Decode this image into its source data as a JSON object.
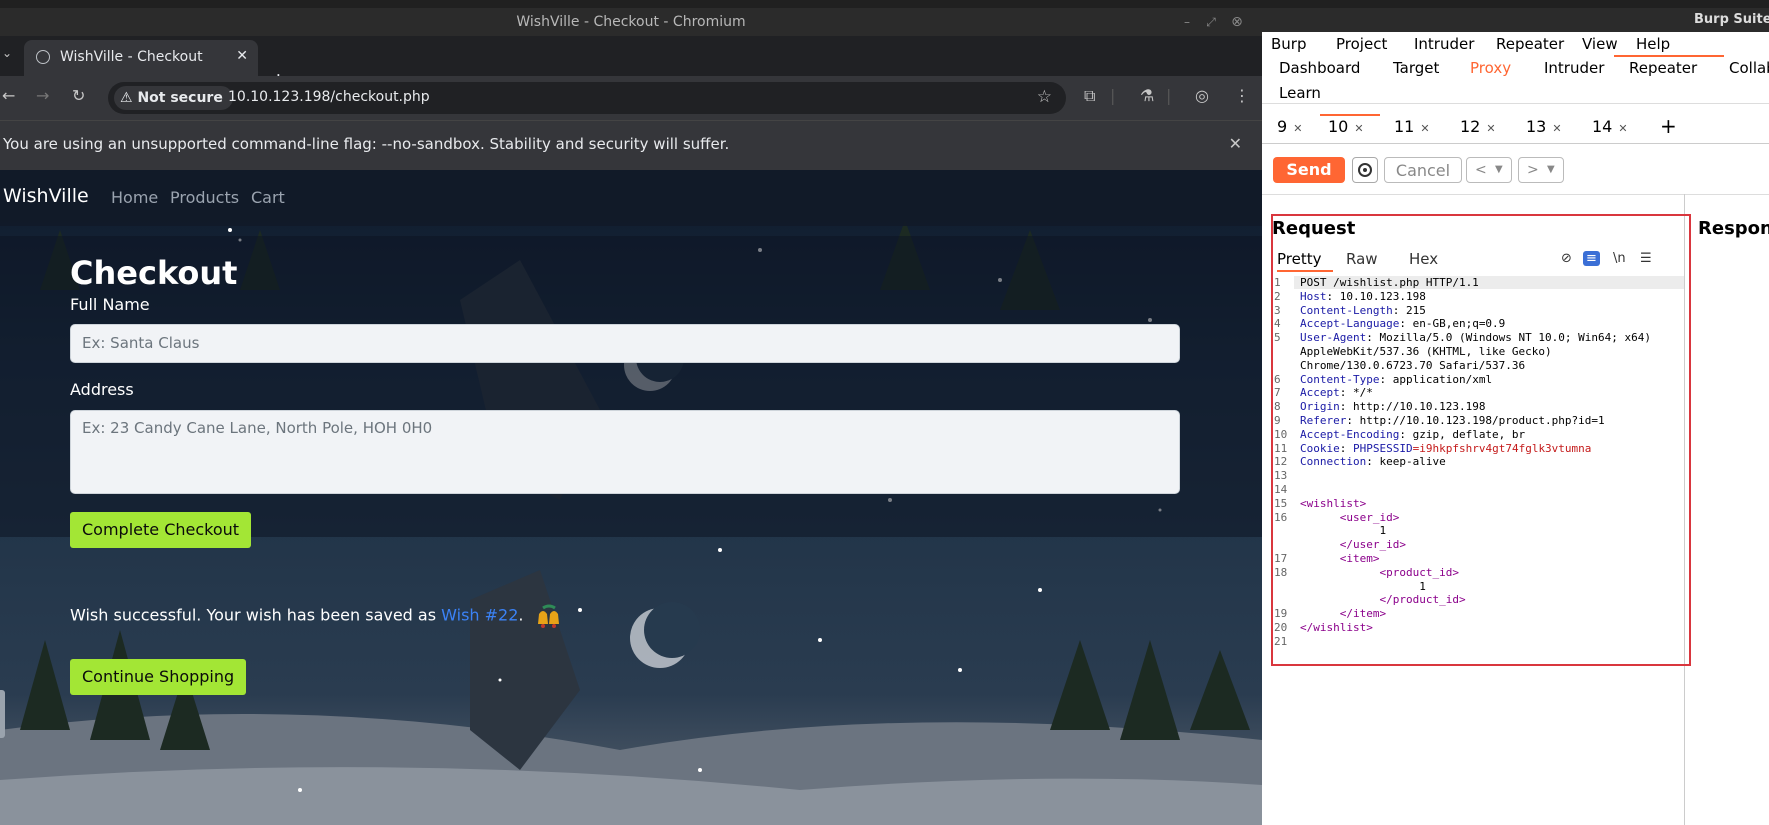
{
  "chromium": {
    "window_title": "WishVille - Checkout - Chromium",
    "tab_title": "WishVille - Checkout",
    "security_label": "Not secure",
    "url": "10.10.123.198/checkout.php",
    "infobar_message": "You are using an unsupported command-line flag: --no-sandbox. Stability and security will suffer."
  },
  "site": {
    "brand": "WishVille",
    "nav": [
      "Home",
      "Products",
      "Cart"
    ],
    "heading": "Checkout",
    "full_name_label": "Full Name",
    "full_name_placeholder": "Ex: Santa Claus",
    "address_label": "Address",
    "address_placeholder": "Ex: 23 Candy Cane Lane, North Pole, HOH 0H0",
    "complete_button": "Complete Checkout",
    "success_prefix": "Wish successful. Your wish has been saved as ",
    "success_link": "Wish #22",
    "success_suffix": ".",
    "continue_button": "Continue Shopping"
  },
  "burp": {
    "window_title": "Burp Suite",
    "menu": [
      "Burp",
      "Project",
      "Intruder",
      "Repeater",
      "View",
      "Help"
    ],
    "tabs_row1": [
      "Dashboard",
      "Target",
      "Proxy",
      "Intruder",
      "Repeater",
      "Collab"
    ],
    "tabs_row2": [
      "Learn"
    ],
    "active_tab": "Repeater",
    "highlight_tab": "Proxy",
    "repeater_tabs": [
      "9",
      "10",
      "11",
      "12",
      "13",
      "14"
    ],
    "active_repeater_tab": "10",
    "send_label": "Send",
    "cancel_label": "Cancel",
    "request_title": "Request",
    "response_title": "Respon",
    "subtabs": [
      "Pretty",
      "Raw",
      "Hex"
    ],
    "accent_color": "#ff6633",
    "request_lines": [
      {
        "n": "1",
        "k": "",
        "v": "POST /wishlist.php HTTP/1.1"
      },
      {
        "n": "2",
        "k": "Host",
        "v": ": 10.10.123.198"
      },
      {
        "n": "3",
        "k": "Content-Length",
        "v": ": 215"
      },
      {
        "n": "4",
        "k": "Accept-Language",
        "v": ": en-GB,en;q=0.9"
      },
      {
        "n": "5",
        "k": "User-Agent",
        "v": ": Mozilla/5.0 (Windows NT 10.0; Win64; x64)"
      },
      {
        "n": "",
        "k": "",
        "v": "AppleWebKit/537.36 (KHTML, like Gecko)"
      },
      {
        "n": "",
        "k": "",
        "v": "Chrome/130.0.6723.70 Safari/537.36"
      },
      {
        "n": "6",
        "k": "Content-Type",
        "v": ": application/xml"
      },
      {
        "n": "7",
        "k": "Accept",
        "v": ": */*"
      },
      {
        "n": "8",
        "k": "Origin",
        "v": ": http://10.10.123.198"
      },
      {
        "n": "9",
        "k": "Referer",
        "v": ": http://10.10.123.198/product.php?id=1"
      },
      {
        "n": "10",
        "k": "Accept-Encoding",
        "v": ": gzip, deflate, br"
      },
      {
        "n": "11",
        "k": "Cookie",
        "v": ": ",
        "ck": "PHPSESSID",
        "cv": "=i9hkpfshrv4gt74fglk3vtumna"
      },
      {
        "n": "12",
        "k": "Connection",
        "v": ": keep-alive"
      },
      {
        "n": "13",
        "k": "",
        "v": ""
      },
      {
        "n": "14",
        "k": "",
        "v": ""
      },
      {
        "n": "15",
        "t": "<wishlist>"
      },
      {
        "n": "16",
        "t": "      <user_id>"
      },
      {
        "n": "",
        "t": "            1"
      },
      {
        "n": "",
        "t": "      </user_id>"
      },
      {
        "n": "17",
        "t": "      <item>"
      },
      {
        "n": "18",
        "t": "            <product_id>"
      },
      {
        "n": "",
        "t": "                  1"
      },
      {
        "n": "",
        "t": "            </product_id>"
      },
      {
        "n": "19",
        "t": "      </item>"
      },
      {
        "n": "20",
        "t": "</wishlist>"
      },
      {
        "n": "21",
        "t": ""
      }
    ]
  }
}
